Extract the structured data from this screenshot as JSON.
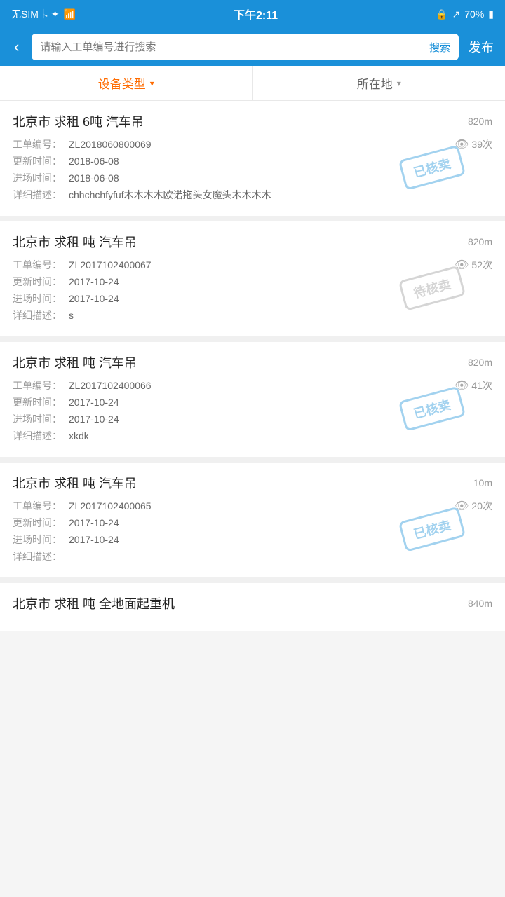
{
  "statusBar": {
    "left": "无SIM卡 ✦",
    "time": "下午2:11",
    "battery": "70%"
  },
  "nav": {
    "backLabel": "‹",
    "searchPlaceholder": "请输入工单编号进行搜索",
    "searchBtn": "搜索",
    "publishBtn": "发布"
  },
  "filterBar": {
    "item1Label": "设备类型",
    "item2Label": "所在地"
  },
  "items": [
    {
      "title": "北京市 求租 6吨 汽车吊",
      "distance": "820m",
      "orderNo": "ZL2018060800069",
      "views": "39次",
      "updateTime": "2018-06-08",
      "entryTime": "2018-06-08",
      "description": "chhchchfyfuf木木木木欧诺拖头女魔头木木木木",
      "stampType": "sold",
      "stampText": "已核卖"
    },
    {
      "title": "北京市 求租 吨 汽车吊",
      "distance": "820m",
      "orderNo": "ZL2017102400067",
      "views": "52次",
      "updateTime": "2017-10-24",
      "entryTime": "2017-10-24",
      "description": "s",
      "stampType": "pending",
      "stampText": "待核卖"
    },
    {
      "title": "北京市 求租 吨 汽车吊",
      "distance": "820m",
      "orderNo": "ZL2017102400066",
      "views": "41次",
      "updateTime": "2017-10-24",
      "entryTime": "2017-10-24",
      "description": "xkdk",
      "stampType": "sold",
      "stampText": "已核卖"
    },
    {
      "title": "北京市 求租 吨 汽车吊",
      "distance": "10m",
      "orderNo": "ZL2017102400065",
      "views": "20次",
      "updateTime": "2017-10-24",
      "entryTime": "2017-10-24",
      "description": "",
      "stampType": "sold",
      "stampText": "已核卖"
    },
    {
      "title": "北京市 求租 吨 全地面起重机",
      "distance": "840m",
      "orderNo": "",
      "views": "",
      "updateTime": "",
      "entryTime": "",
      "description": "",
      "stampType": "none",
      "stampText": ""
    }
  ],
  "labels": {
    "orderNoLabel": "工单编号：",
    "updateLabel": "更新时间：",
    "entryLabel": "进场时间：",
    "descLabel": "详细描述："
  }
}
